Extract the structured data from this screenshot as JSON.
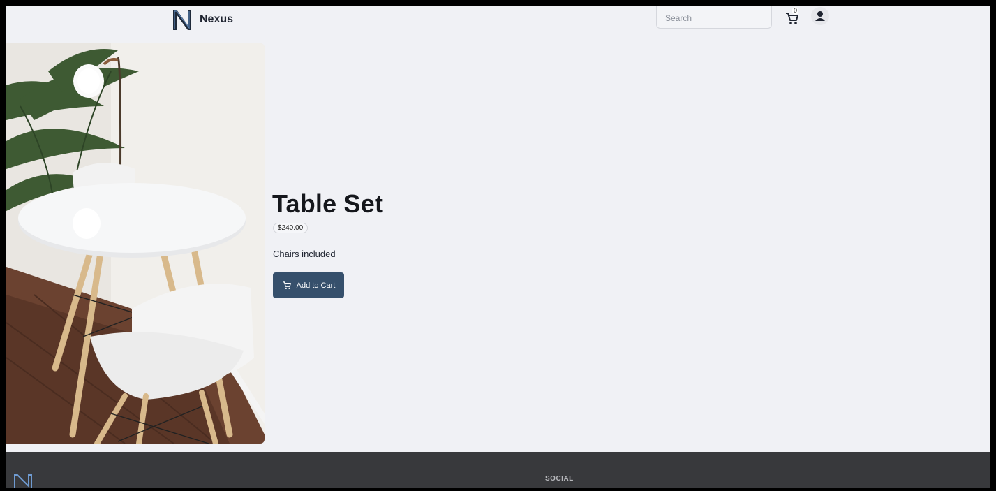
{
  "header": {
    "brand": "Nexus",
    "search_placeholder": "Search",
    "cart_count": "0"
  },
  "product": {
    "title": "Table Set",
    "price": "$240.00",
    "description": "Chairs included",
    "add_to_cart_label": "Add to Cart"
  },
  "footer": {
    "social_heading": "SOCIAL"
  },
  "icons": {
    "logo": "nexus-logo",
    "cart": "cart-icon",
    "user": "user-icon"
  },
  "colors": {
    "page_bg": "#f0f1f5",
    "accent_button": "#36506c",
    "footer_bg": "#38393c"
  }
}
